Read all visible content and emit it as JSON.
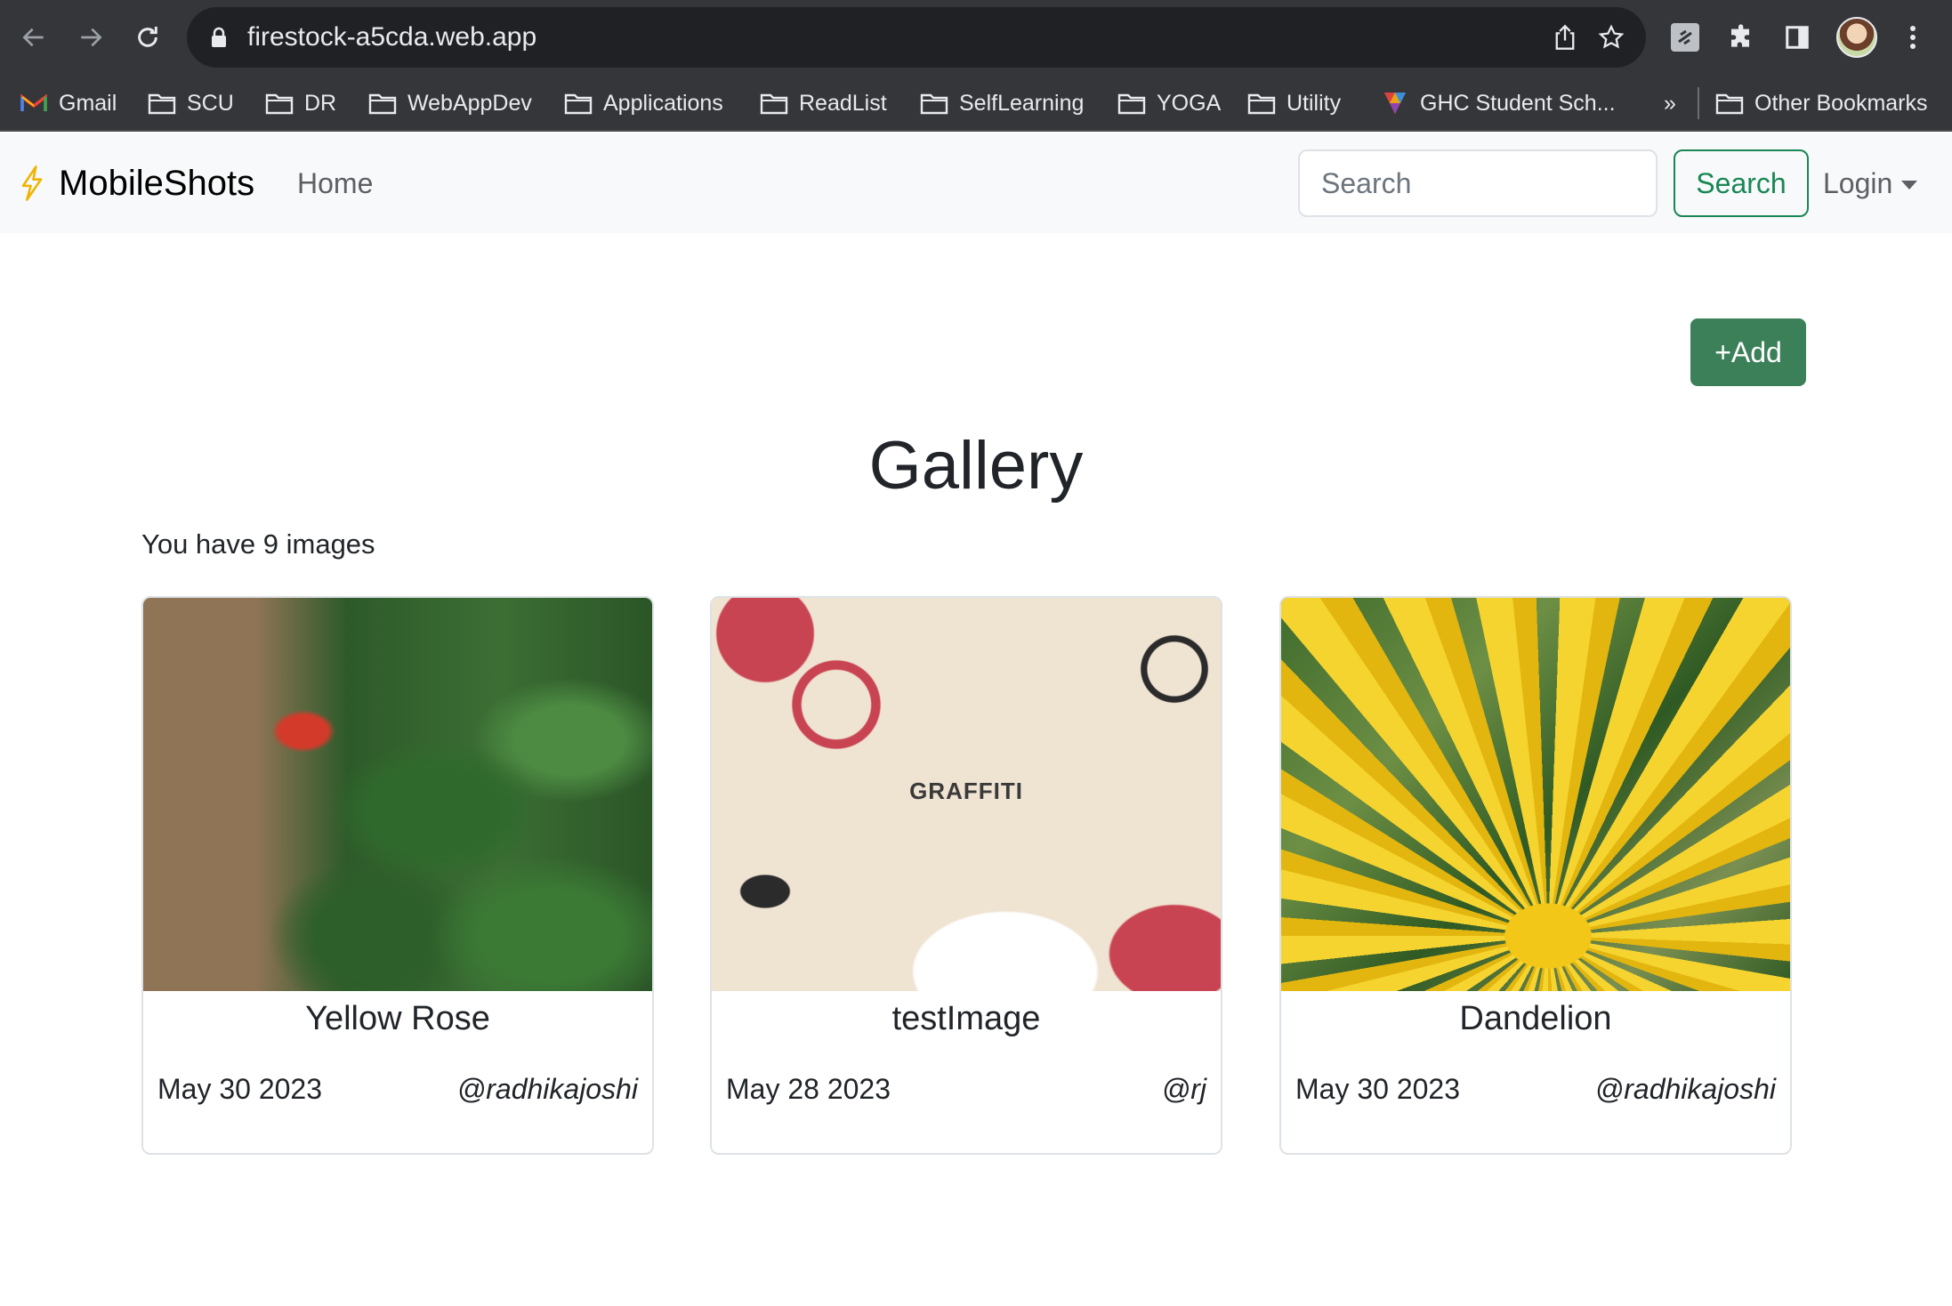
{
  "browser": {
    "url": "firestock-a5cda.web.app",
    "bookmarks": [
      {
        "label": "Gmail",
        "icon": "gmail-icon"
      },
      {
        "label": "SCU",
        "icon": "folder-icon"
      },
      {
        "label": "DR",
        "icon": "folder-icon"
      },
      {
        "label": "WebAppDev",
        "icon": "folder-icon"
      },
      {
        "label": "Applications",
        "icon": "folder-icon"
      },
      {
        "label": "ReadList",
        "icon": "folder-icon"
      },
      {
        "label": "SelfLearning",
        "icon": "folder-icon"
      },
      {
        "label": "YOGA",
        "icon": "folder-icon"
      },
      {
        "label": "Utility",
        "icon": "folder-icon"
      },
      {
        "label": "GHC Student Sch...",
        "icon": "ghc-icon"
      }
    ],
    "overflow_label": "»",
    "other_bookmarks": "Other Bookmarks"
  },
  "navbar": {
    "brand": "MobileShots",
    "brand_icon": "lightning-icon",
    "home": "Home",
    "search_placeholder": "Search",
    "search_button": "Search",
    "login": "Login"
  },
  "main": {
    "add_button": "+Add",
    "title": "Gallery",
    "count_text": "You have 9 images"
  },
  "cards": [
    {
      "title": "Yellow Rose",
      "date": "May 30 2023",
      "user": "@radhikajoshi"
    },
    {
      "title": "testImage",
      "date": "May 28 2023",
      "user": "@rj",
      "image_text": "GRAFFITI"
    },
    {
      "title": "Dandelion",
      "date": "May 30 2023",
      "user": "@radhikajoshi"
    }
  ],
  "colors": {
    "chrome": "#35363a",
    "omnibox": "#202124",
    "navbar_bg": "#f8f9fa",
    "success": "#198754",
    "add_button": "#3b8058",
    "brand_bolt": "#f0b400"
  }
}
